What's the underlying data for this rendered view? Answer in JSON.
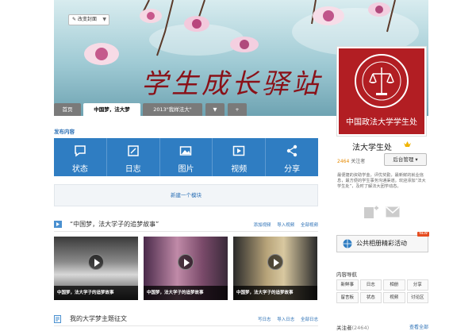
{
  "banner": {
    "title": "学生成长驿站",
    "cover_button": "改变封面"
  },
  "tabs": {
    "home": "首页",
    "active": "中国梦，法大梦",
    "third": "2013\"我样法大\"",
    "more": "▼",
    "add": "+"
  },
  "profile": {
    "logo_text": "中国政法大学学生处",
    "name": "法大学生处",
    "followers_count": "2464",
    "followers_label": "关注者",
    "admin_button": "后台管理",
    "description": "最便捷的资助学金，评优奖勤，最新鲜的就业信息，最方便的学生事务沟通渠道。欢迎添加“法大学生处”，及时了解法大团学动态。"
  },
  "album": {
    "label": "公共相册精彩活动",
    "badge": "NEW"
  },
  "content_nav": {
    "title": "内容导航",
    "items": [
      "新鲜事",
      "日志",
      "相册",
      "分享",
      "留言板",
      "状态",
      "视频",
      "讨论区"
    ]
  },
  "fans": {
    "title": "关注者",
    "count": "(2464)",
    "see_all": "查看全部"
  },
  "publish": {
    "label": "发布内容",
    "actions": [
      {
        "icon": "status-icon",
        "label": "状态"
      },
      {
        "icon": "blog-icon",
        "label": "日志"
      },
      {
        "icon": "photo-icon",
        "label": "图片"
      },
      {
        "icon": "video-icon",
        "label": "视频"
      },
      {
        "icon": "share-icon",
        "label": "分享"
      }
    ]
  },
  "new_module": "新建一个模块",
  "video_section": {
    "title": "“中国梦，法大学子的追梦故事”",
    "ops": [
      "添加视频",
      "导入视频",
      "全部视频"
    ],
    "videos": [
      {
        "caption": "中国梦，法大学子的追梦故事"
      },
      {
        "caption": "中国梦，法大学子的追梦故事"
      },
      {
        "caption": "中国梦，法大学子的追梦故事"
      }
    ]
  },
  "essay_section": {
    "title": "我的大学梦主题征文",
    "ops": [
      "写日志",
      "导入日志",
      "全部日志"
    ]
  },
  "colors": {
    "brand_blue": "#2f7dc2",
    "seal_red": "#b21e23",
    "title_red": "#8a1118"
  }
}
